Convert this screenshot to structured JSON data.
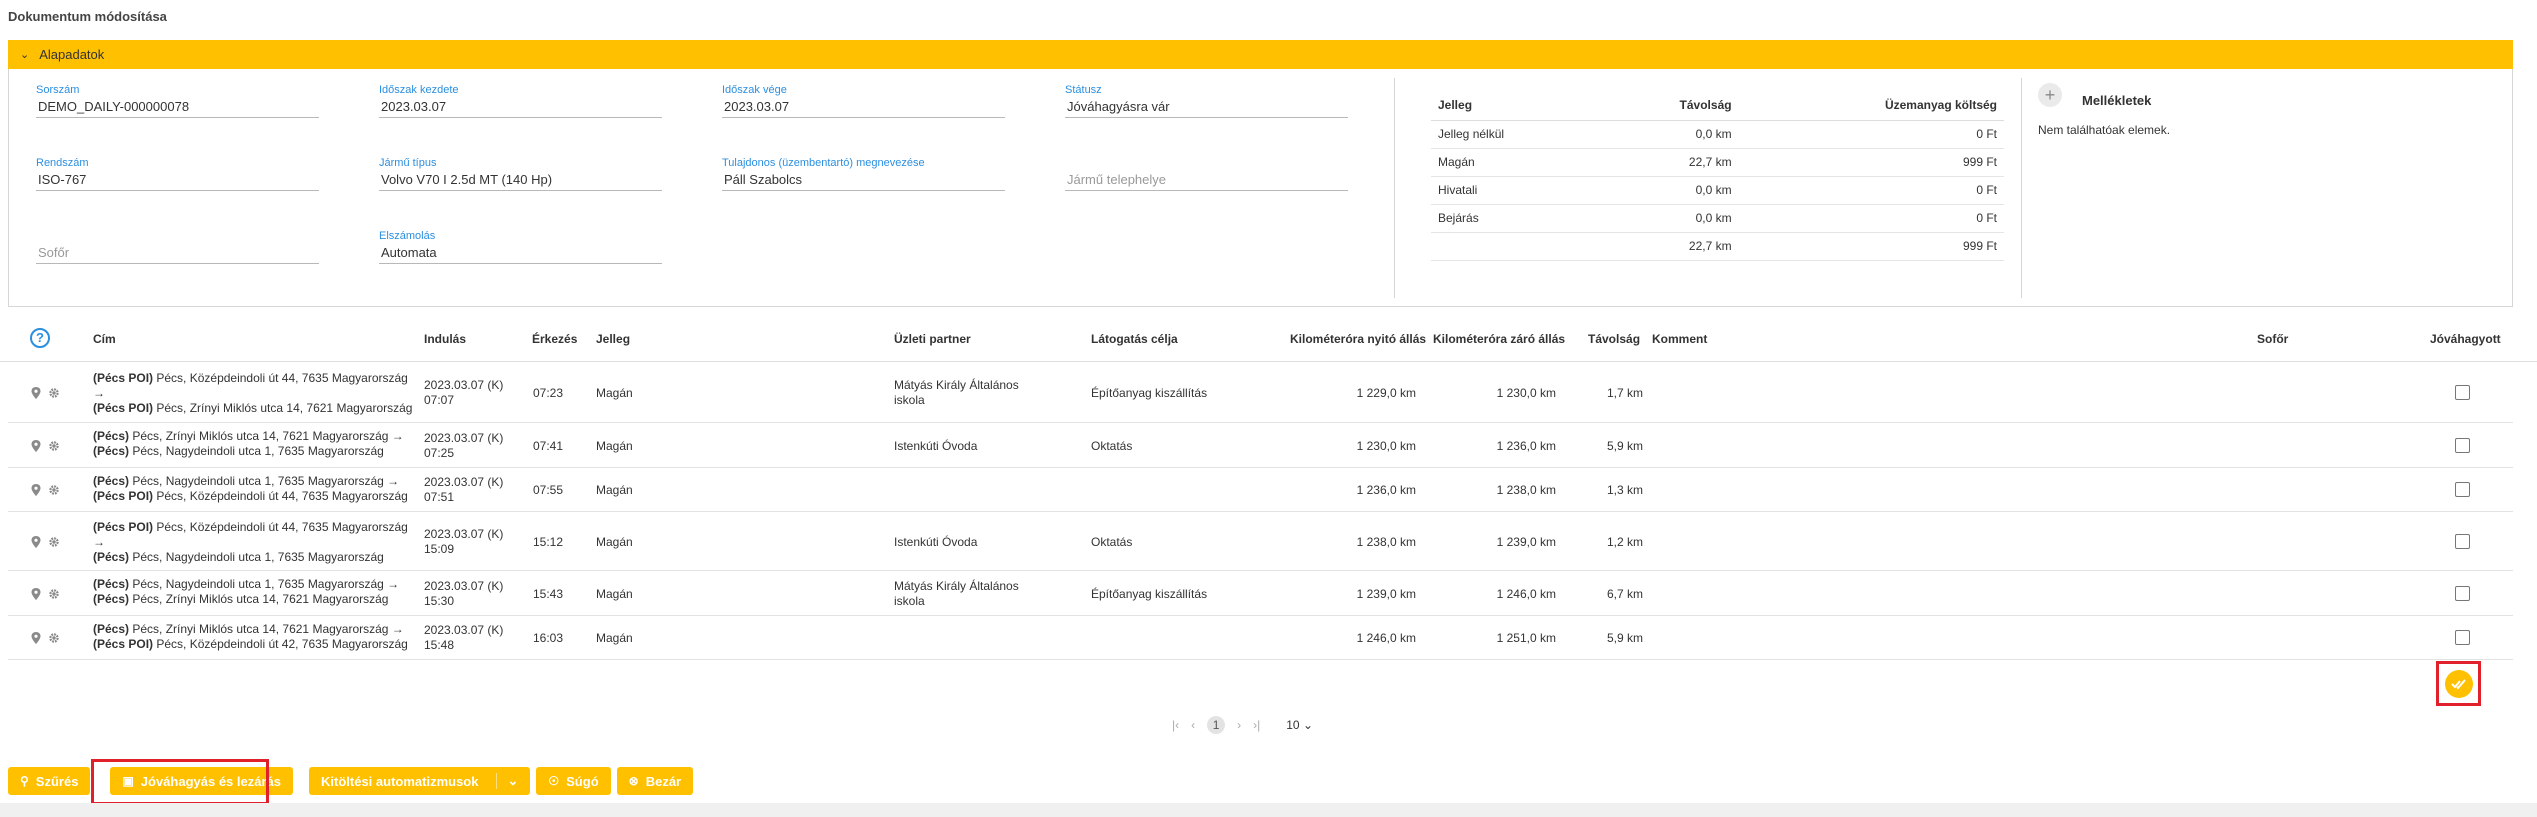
{
  "page": {
    "title": "Dokumentum módosítása"
  },
  "panel": {
    "title": "Alapadatok"
  },
  "fields": {
    "sorszam": {
      "label": "Sorszám",
      "value": "DEMO_DAILY-000000078"
    },
    "idoszak_kezdete": {
      "label": "Időszak kezdete",
      "value": "2023.03.07"
    },
    "idoszak_vege": {
      "label": "Időszak vége",
      "value": "2023.03.07"
    },
    "statusz": {
      "label": "Státusz",
      "value": "Jóváhagyásra vár"
    },
    "rendszam": {
      "label": "Rendszám",
      "value": "ISO-767"
    },
    "jarmu_tipus": {
      "label": "Jármű típus",
      "value": "Volvo V70 I 2.5d MT (140 Hp)"
    },
    "tulajdonos": {
      "label": "Tulajdonos (üzembentartó) megnevezése",
      "value": "Páll Szabolcs"
    },
    "jarmu_telephelye": {
      "placeholder": "Jármű telephelye"
    },
    "sofor": {
      "placeholder": "Sofőr"
    },
    "elszamolas": {
      "label": "Elszámolás",
      "value": "Automata"
    }
  },
  "summary": {
    "headers": [
      "Jelleg",
      "Távolság",
      "Üzemanyag költség"
    ],
    "rows": [
      [
        "Jelleg nélkül",
        "0,0 km",
        "0 Ft"
      ],
      [
        "Magán",
        "22,7 km",
        "999 Ft"
      ],
      [
        "Hivatali",
        "0,0 km",
        "0 Ft"
      ],
      [
        "Bejárás",
        "0,0 km",
        "0 Ft"
      ],
      [
        "",
        "22,7 km",
        "999 Ft"
      ]
    ]
  },
  "attachments": {
    "title": "Mellékletek",
    "empty": "Nem találhatóak elemek.",
    "add_symbol": "+"
  },
  "grid": {
    "help_symbol": "?",
    "headers": {
      "cim": "Cím",
      "indulas": "Indulás",
      "erkezes": "Érkezés",
      "jelleg": "Jelleg",
      "partner": "Üzleti partner",
      "cel": "Látogatás célja",
      "nyito": "Kilométeróra nyitó állás",
      "zaro": "Kilométeróra záró állás",
      "tavolsag": "Távolság",
      "komment": "Komment",
      "sofor": "Sofőr",
      "jovahagyott": "Jóváhagyott"
    },
    "rows": [
      {
        "from_tag": "(Pécs POI)",
        "from_addr": " Pécs, Középdeindoli út 44, 7635 Magyarország",
        "arrow_line": "→",
        "to_tag": "(Pécs POI)",
        "to_addr": " Pécs, Zrínyi Miklós utca 14, 7621 Magyarország",
        "ind_date": "2023.03.07 (K)",
        "ind_time": "07:07",
        "erk": "07:23",
        "jelleg": "Magán",
        "partner1": "Mátyás Király Általános",
        "partner2": "iskola",
        "cel": "Építőanyag kiszállítás",
        "nyito": "1 229,0 km",
        "zaro": "1 230,0 km",
        "tav": "1,7 km"
      },
      {
        "from_tag": "(Pécs)",
        "from_addr": " Pécs, Zrínyi Miklós utca 14, 7621 Magyarország →",
        "arrow_line": "",
        "to_tag": "(Pécs)",
        "to_addr": " Pécs, Nagydeindoli utca 1, 7635 Magyarország",
        "ind_date": "2023.03.07 (K)",
        "ind_time": "07:25",
        "erk": "07:41",
        "jelleg": "Magán",
        "partner1": "Istenkúti Óvoda",
        "partner2": "",
        "cel": "Oktatás",
        "nyito": "1 230,0 km",
        "zaro": "1 236,0 km",
        "tav": "5,9 km"
      },
      {
        "from_tag": "(Pécs)",
        "from_addr": " Pécs, Nagydeindoli utca 1, 7635 Magyarország →",
        "arrow_line": "",
        "to_tag": "(Pécs POI)",
        "to_addr": " Pécs, Középdeindoli út 44, 7635 Magyarország",
        "ind_date": "2023.03.07 (K)",
        "ind_time": "07:51",
        "erk": "07:55",
        "jelleg": "Magán",
        "partner1": "",
        "partner2": "",
        "cel": "",
        "nyito": "1 236,0 km",
        "zaro": "1 238,0 km",
        "tav": "1,3 km"
      },
      {
        "from_tag": "(Pécs POI)",
        "from_addr": " Pécs, Középdeindoli út 44, 7635 Magyarország",
        "arrow_line": "→",
        "to_tag": "(Pécs)",
        "to_addr": " Pécs, Nagydeindoli utca 1, 7635 Magyarország",
        "ind_date": "2023.03.07 (K)",
        "ind_time": "15:09",
        "erk": "15:12",
        "jelleg": "Magán",
        "partner1": "Istenkúti Óvoda",
        "partner2": "",
        "cel": "Oktatás",
        "nyito": "1 238,0 km",
        "zaro": "1 239,0 km",
        "tav": "1,2 km"
      },
      {
        "from_tag": "(Pécs)",
        "from_addr": " Pécs, Nagydeindoli utca 1, 7635 Magyarország →",
        "arrow_line": "",
        "to_tag": "(Pécs)",
        "to_addr": " Pécs, Zrínyi Miklós utca 14, 7621 Magyarország",
        "ind_date": "2023.03.07 (K)",
        "ind_time": "15:30",
        "erk": "15:43",
        "jelleg": "Magán",
        "partner1": "Mátyás Király Általános",
        "partner2": "iskola",
        "cel": "Építőanyag kiszállítás",
        "nyito": "1 239,0 km",
        "zaro": "1 246,0 km",
        "tav": "6,7 km"
      },
      {
        "from_tag": "(Pécs)",
        "from_addr": " Pécs, Zrínyi Miklós utca 14, 7621 Magyarország →",
        "arrow_line": "",
        "to_tag": "(Pécs POI)",
        "to_addr": " Pécs, Középdeindoli út 42, 7635 Magyarország",
        "ind_date": "2023.03.07 (K)",
        "ind_time": "15:48",
        "erk": "16:03",
        "jelleg": "Magán",
        "partner1": "",
        "partner2": "",
        "cel": "",
        "nyito": "1 246,0 km",
        "zaro": "1 251,0 km",
        "tav": "5,9 km"
      }
    ]
  },
  "pager": {
    "first": "|‹",
    "prev": "‹",
    "current": "1",
    "next": "›",
    "last": "›|",
    "page_size": "10"
  },
  "toolbar": {
    "filter": "Szűrés",
    "approve_close": "Jóváhagyás és lezárás",
    "autofill": "Kitöltési automatizmusok",
    "help": "Súgó",
    "close": "Bezár"
  },
  "colors": {
    "accent": "#ffc000",
    "link": "#2b8fe0",
    "highlight": "#e0202a"
  }
}
